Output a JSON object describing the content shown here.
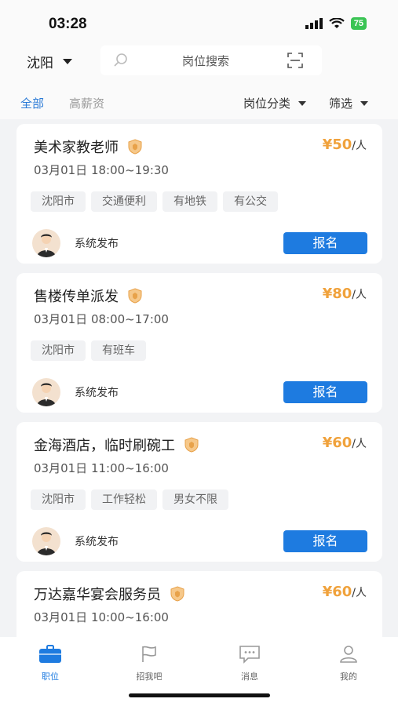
{
  "status_bar": {
    "time": "03:28",
    "battery": "75"
  },
  "header": {
    "city": "沈阳",
    "search_placeholder": "岗位搜索"
  },
  "filters": {
    "tab_all": "全部",
    "tab_high_pay": "高薪资",
    "category": "岗位分类",
    "filter": "筛选"
  },
  "jobs": [
    {
      "title": "美术家教老师",
      "price": "¥50",
      "unit": "/人",
      "time": "03月01日 18:00~19:30",
      "tags": [
        "沈阳市",
        "交通便利",
        "有地铁",
        "有公交"
      ],
      "publisher": "系统发布",
      "button": "报名"
    },
    {
      "title": "售楼传单派发",
      "price": "¥80",
      "unit": "/人",
      "time": "03月01日 08:00~17:00",
      "tags": [
        "沈阳市",
        "有班车"
      ],
      "publisher": "系统发布",
      "button": "报名"
    },
    {
      "title": "金海酒店，临时刷碗工",
      "price": "¥60",
      "unit": "/人",
      "time": "03月01日 11:00~16:00",
      "tags": [
        "沈阳市",
        "工作轻松",
        "男女不限"
      ],
      "publisher": "系统发布",
      "button": "报名"
    },
    {
      "title": "万达嘉华宴会服务员",
      "price": "¥60",
      "unit": "/人",
      "time": "03月01日 10:00~16:00",
      "tags": [],
      "publisher": "",
      "button": ""
    }
  ],
  "tab_bar": [
    {
      "label": "职位",
      "icon": "briefcase-icon",
      "active": true
    },
    {
      "label": "招我吧",
      "icon": "flag-icon",
      "active": false
    },
    {
      "label": "消息",
      "icon": "message-icon",
      "active": false
    },
    {
      "label": "我的",
      "icon": "user-icon",
      "active": false
    }
  ],
  "colors": {
    "accent": "#1e7be0",
    "price": "#f0a23c",
    "tab_active": "#2a7ad6"
  }
}
